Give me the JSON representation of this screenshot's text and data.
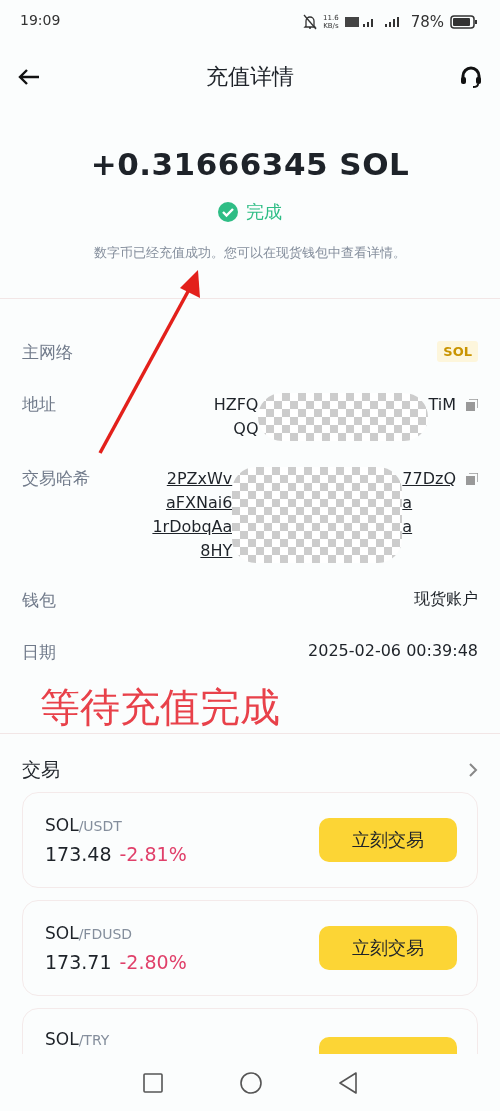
{
  "status_bar": {
    "time": "19:09",
    "speed": "11.6",
    "speed_unit": "KB/s",
    "battery": "78%"
  },
  "header": {
    "title": "充值详情"
  },
  "amount": "+0.31666345 SOL",
  "status": {
    "label": "完成",
    "done": true
  },
  "description": "数字币已经充值成功。您可以在现货钱包中查看详情。",
  "details": [
    {
      "kind": "tag",
      "label": "主网络",
      "value": "SOL"
    },
    {
      "kind": "masked",
      "label": "地址",
      "link": false,
      "lines": [
        {
          "left": "HZFQ",
          "right": "TiM"
        },
        {
          "left": "QQ"
        }
      ]
    },
    {
      "kind": "masked",
      "label": "交易哈希",
      "link": true,
      "lines": [
        {
          "left": "2PZxWv",
          "right": "77DzQ"
        },
        {
          "left": "aFXNai6",
          "right": "a"
        },
        {
          "left": "1rDobqAa",
          "right": "a"
        },
        {
          "left": "8HY"
        }
      ]
    },
    {
      "kind": "text",
      "label": "钱包",
      "value": "现货账户"
    },
    {
      "kind": "text",
      "label": "日期",
      "value": "2025-02-06 00:39:48"
    }
  ],
  "annotation": {
    "text": "等待充值完成"
  },
  "trade": {
    "title": "交易",
    "pairs": [
      {
        "base": "SOL",
        "quote": "/USDT",
        "price": "173.48",
        "change": "-2.81%",
        "button": "立刻交易"
      },
      {
        "base": "SOL",
        "quote": "/FDUSD",
        "price": "173.71",
        "change": "-2.80%",
        "button": "立刻交易"
      },
      {
        "base": "SOL",
        "quote": "/TRY"
      }
    ]
  }
}
